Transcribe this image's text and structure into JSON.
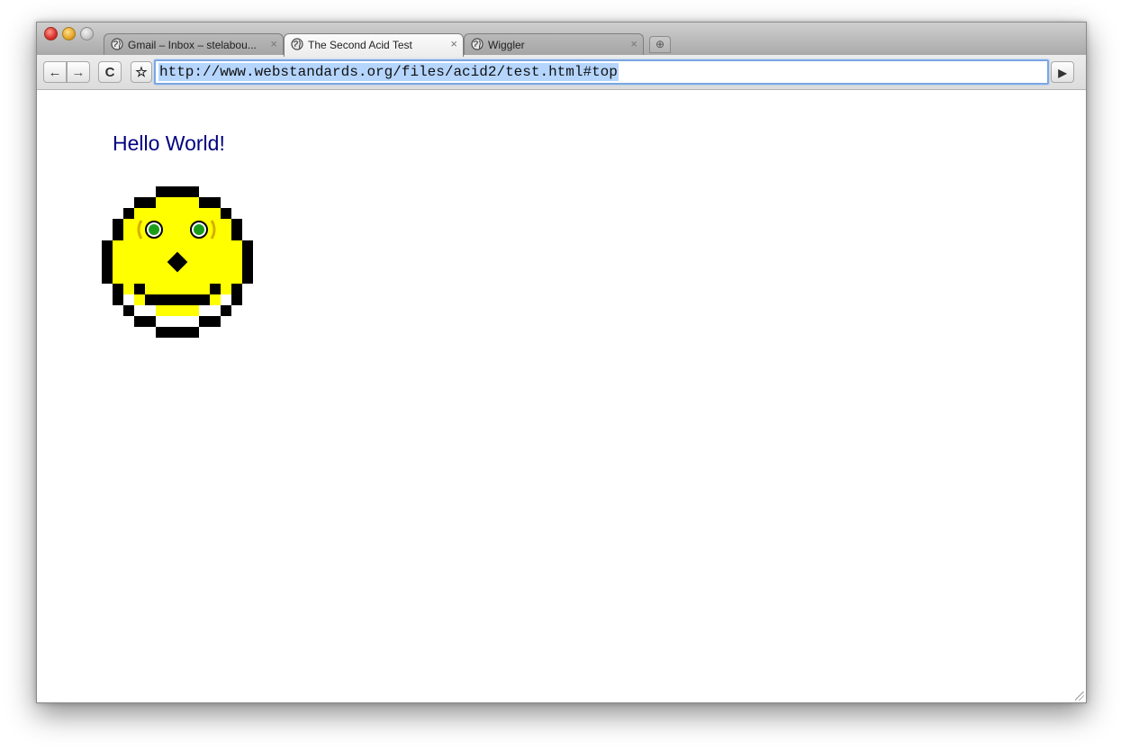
{
  "tabs": [
    {
      "title": "Gmail – Inbox – stelabou...",
      "icon": "globe-icon",
      "close": "×"
    },
    {
      "title": "The Second Acid Test",
      "icon": "globe-icon",
      "close": "×"
    },
    {
      "title": "Wiggler",
      "icon": "globe-icon",
      "close": "×"
    }
  ],
  "new_tab_label": "⊕",
  "toolbar": {
    "back": "←",
    "forward": "→",
    "reload": "C",
    "star": "☆",
    "go": "▶"
  },
  "address": {
    "url": "http://www.webstandards.org/files/acid2/test.html#top"
  },
  "page": {
    "heading": "Hello World!",
    "heading_color": "#000080",
    "face_color": "#ffff00",
    "eye_color": "#1a9e1a"
  }
}
